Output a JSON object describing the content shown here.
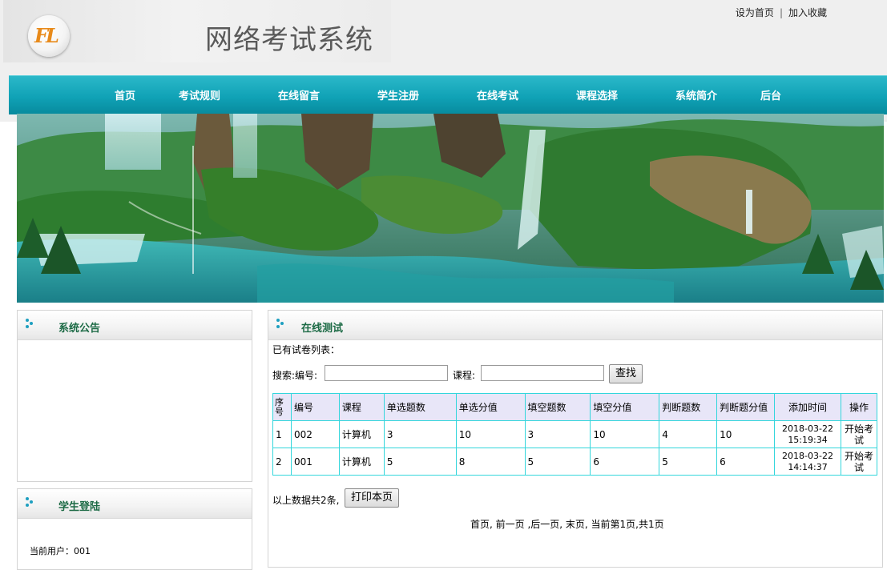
{
  "header": {
    "logo_text": "FL",
    "site_title": "网络考试系统",
    "set_home": "设为首页",
    "separator": "|",
    "add_favorite": "加入收藏"
  },
  "nav": [
    {
      "label": "首页"
    },
    {
      "label": "考试规则"
    },
    {
      "label": "在线留言"
    },
    {
      "label": "学生注册"
    },
    {
      "label": "在线考试"
    },
    {
      "label": "课程选择"
    },
    {
      "label": "系统简介"
    },
    {
      "label": "后台"
    }
  ],
  "notice_panel": {
    "title": "系统公告"
  },
  "login_panel": {
    "title": "学生登陆",
    "current_user": "当前用户：001"
  },
  "test_panel": {
    "title": "在线测试",
    "list_caption": "已有试卷列表：",
    "search_label": "搜索:编号:",
    "search_id_value": "",
    "course_label": "课程:",
    "course_value": "",
    "search_button": "查找",
    "columns": [
      "序号",
      "编号",
      "课程",
      "单选题数",
      "单选分值",
      "填空题数",
      "填空分值",
      "判断题数",
      "判断题分值",
      "添加时间",
      "操作"
    ],
    "rows": [
      {
        "no": "1",
        "code": "002",
        "course": "计算机",
        "single_count": "3",
        "single_score": "10",
        "blank_count": "3",
        "blank_score": "10",
        "judge_count": "4",
        "judge_score": "10",
        "added": "2018-03-22 15:19:34",
        "action": "开始考试"
      },
      {
        "no": "2",
        "code": "001",
        "course": "计算机",
        "single_count": "5",
        "single_score": "8",
        "blank_count": "5",
        "blank_score": "6",
        "judge_count": "5",
        "judge_score": "6",
        "added": "2018-03-22 14:14:37",
        "action": "开始考试"
      }
    ],
    "total_text": "以上数据共2条,",
    "print_button": "打印本页",
    "pager": "首页, 前一页 ,后一页, 末页, 当前第1页,共1页"
  },
  "colors": {
    "nav": "#10a2b6",
    "table_border": "#33d6dc",
    "header_bg": "#efefef",
    "panel_title": "#1c6a45"
  }
}
